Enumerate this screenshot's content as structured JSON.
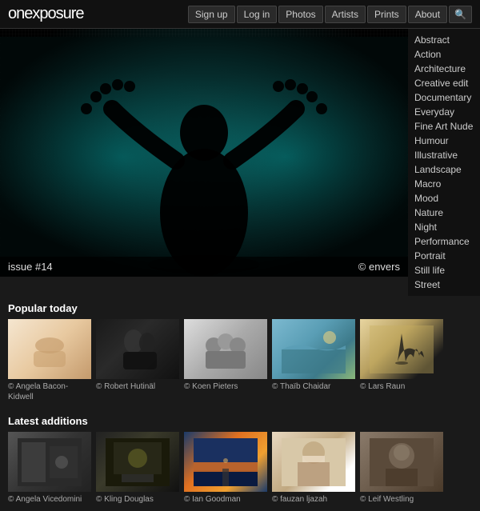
{
  "header": {
    "logo_on": "on",
    "logo_exposure": "exposure",
    "nav": {
      "signup": "Sign up",
      "login": "Log in",
      "photos": "Photos",
      "artists": "Artists",
      "prints": "Prints",
      "about": "About"
    }
  },
  "sidebar": {
    "categories": [
      "Abstract",
      "Action",
      "Architecture",
      "Creative edit",
      "Documentary",
      "Everyday",
      "Fine Art Nude",
      "Humour",
      "Illustrative",
      "Landscape",
      "Macro",
      "Mood",
      "Nature",
      "Night",
      "Performance",
      "Portrait",
      "Still life",
      "Street"
    ]
  },
  "hero": {
    "issue": "issue #14",
    "credit": "© envers"
  },
  "popular": {
    "title": "Popular today",
    "items": [
      {
        "credit": "© Angela Bacon-Kidwell"
      },
      {
        "credit": "© Robert Hutinäl"
      },
      {
        "credit": "© Koen Pieters"
      },
      {
        "credit": "© Thaïb Chaidar"
      },
      {
        "credit": "© Lars Raun"
      }
    ]
  },
  "latest": {
    "title": "Latest additions",
    "items": [
      {
        "credit": "© Angela Vicedomini"
      },
      {
        "credit": "© Kling Douglas"
      },
      {
        "credit": "© Ian Goodman"
      },
      {
        "credit": "© fauzan ljazah"
      },
      {
        "credit": "© Leif Westling"
      }
    ]
  }
}
